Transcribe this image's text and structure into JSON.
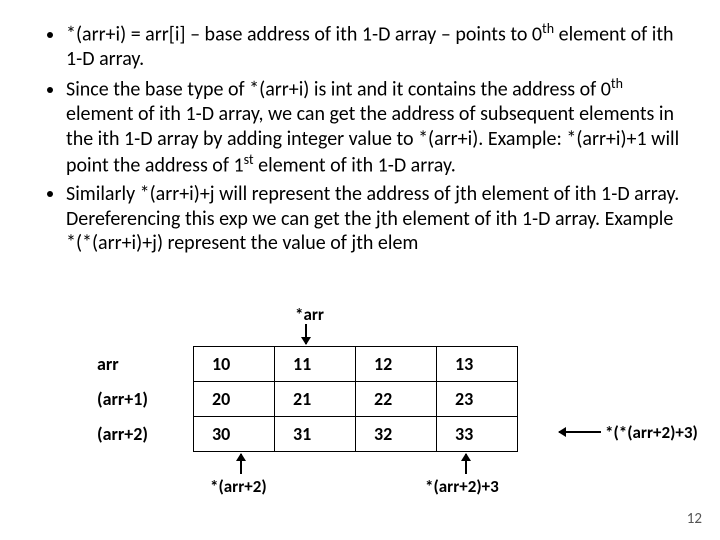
{
  "bullets": {
    "b1_pre": "*(arr+i) = arr[i] – base address of ith  1-D array – points to 0",
    "b1_sup": "th",
    "b1_post": " element of ith 1-D array.",
    "b2_pre": "Since the base type of *(arr+i) is int and it contains the address of 0",
    "b2_sup": "th",
    "b2_mid": " element of ith 1-D array, we can get the address of subsequent elements in the ith 1-D array by adding integer value to *(arr+i). Example: *(arr+i)+1 will point the address of 1",
    "b2_sup2": "st",
    "b2_post": " element of ith 1-D array.",
    "b3": "Similarly *(arr+i)+j will represent the address of jth element of ith 1-D array. Dereferencing this exp we can get the jth element of ith 1-D array. Example *(*(arr+i)+j) represent the value of jth elem"
  },
  "labels": {
    "star_arr": "*arr",
    "side": "*(*(arr+2)+3)",
    "below_left": "*(arr+2)",
    "below_right": "*(arr+2)+3"
  },
  "chart_data": {
    "type": "table",
    "row_headers": [
      "arr",
      "(arr+1)",
      "(arr+2)"
    ],
    "grid": [
      [
        "10",
        "11",
        "12",
        "13"
      ],
      [
        "20",
        "21",
        "22",
        "23"
      ],
      [
        "30",
        "31",
        "32",
        "33"
      ]
    ]
  },
  "page_number": "12"
}
